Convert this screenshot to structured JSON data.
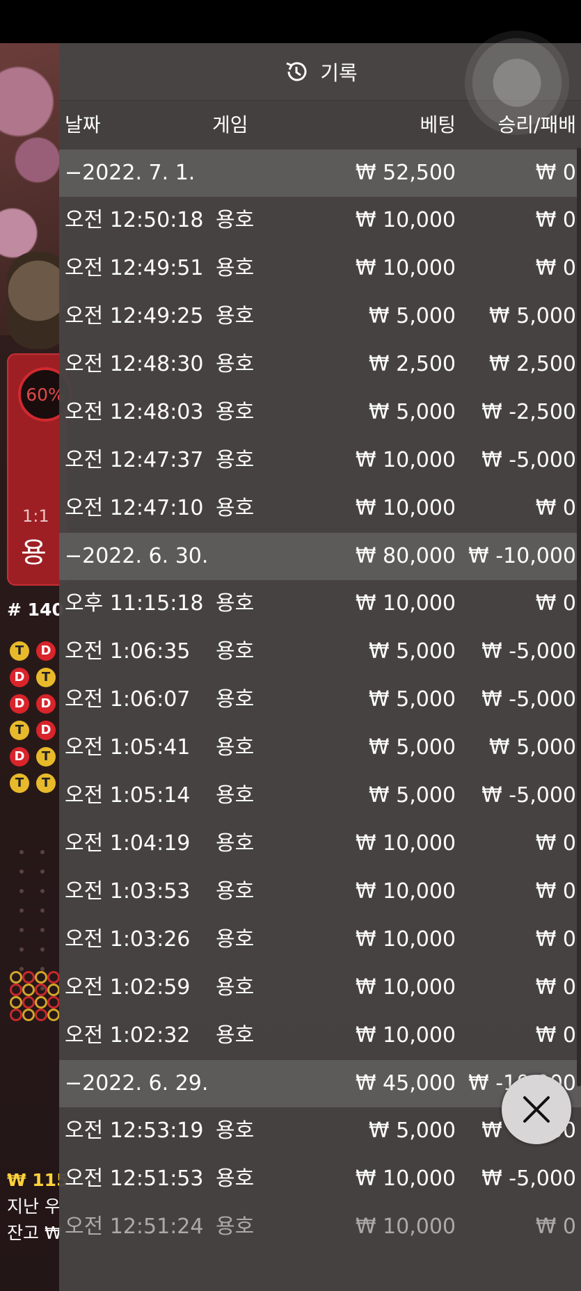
{
  "panel": {
    "title": "기록",
    "icon": "history-icon"
  },
  "columns": {
    "date": "날짜",
    "game": "게임",
    "bet": "베팅",
    "winloss": "승리/패배"
  },
  "groups": [
    {
      "date": "−2022. 7. 1.",
      "bet": "₩ 52,500",
      "result": "₩ 0",
      "rows": [
        {
          "time": "오전 12:50:18",
          "game": "용호",
          "bet": "₩ 10,000",
          "result": "₩ 0"
        },
        {
          "time": "오전 12:49:51",
          "game": "용호",
          "bet": "₩ 10,000",
          "result": "₩ 0"
        },
        {
          "time": "오전 12:49:25",
          "game": "용호",
          "bet": "₩ 5,000",
          "result": "₩ 5,000"
        },
        {
          "time": "오전 12:48:30",
          "game": "용호",
          "bet": "₩ 2,500",
          "result": "₩ 2,500"
        },
        {
          "time": "오전 12:48:03",
          "game": "용호",
          "bet": "₩ 5,000",
          "result": "₩ -2,500"
        },
        {
          "time": "오전 12:47:37",
          "game": "용호",
          "bet": "₩ 10,000",
          "result": "₩ -5,000"
        },
        {
          "time": "오전 12:47:10",
          "game": "용호",
          "bet": "₩ 10,000",
          "result": "₩ 0"
        }
      ]
    },
    {
      "date": "−2022. 6. 30.",
      "bet": "₩ 80,000",
      "result": "₩ -10,000",
      "rows": [
        {
          "time": "오후 11:15:18",
          "game": "용호",
          "bet": "₩ 10,000",
          "result": "₩ 0"
        },
        {
          "time": "오전 1:06:35",
          "game": "용호",
          "bet": "₩ 5,000",
          "result": "₩ -5,000"
        },
        {
          "time": "오전 1:06:07",
          "game": "용호",
          "bet": "₩ 5,000",
          "result": "₩ -5,000"
        },
        {
          "time": "오전 1:05:41",
          "game": "용호",
          "bet": "₩ 5,000",
          "result": "₩ 5,000"
        },
        {
          "time": "오전 1:05:14",
          "game": "용호",
          "bet": "₩ 5,000",
          "result": "₩ -5,000"
        },
        {
          "time": "오전 1:04:19",
          "game": "용호",
          "bet": "₩ 10,000",
          "result": "₩ 0"
        },
        {
          "time": "오전 1:03:53",
          "game": "용호",
          "bet": "₩ 10,000",
          "result": "₩ 0"
        },
        {
          "time": "오전 1:03:26",
          "game": "용호",
          "bet": "₩ 10,000",
          "result": "₩ 0"
        },
        {
          "time": "오전 1:02:59",
          "game": "용호",
          "bet": "₩ 10,000",
          "result": "₩ 0"
        },
        {
          "time": "오전 1:02:32",
          "game": "용호",
          "bet": "₩ 10,000",
          "result": "₩ 0"
        }
      ]
    },
    {
      "date": "−2022. 6. 29.",
      "bet": "₩ 45,000",
      "result": "₩ -10,000",
      "rows": [
        {
          "time": "오전 12:53:19",
          "game": "용호",
          "bet": "₩ 5,000",
          "result": "₩ -5,000"
        },
        {
          "time": "오전 12:51:53",
          "game": "용호",
          "bet": "₩ 10,000",
          "result": "₩ -5,000"
        },
        {
          "time": "오전 12:51:24",
          "game": "용호",
          "bet": "₩ 10,000",
          "result": "₩ 0"
        }
      ]
    }
  ],
  "background": {
    "pct": "60%",
    "odds": "1:1",
    "dragon": "용",
    "round": "# 140",
    "road": [
      [
        "T",
        "D"
      ],
      [
        "D",
        "T"
      ],
      [
        "D",
        "D"
      ],
      [
        "T",
        "D"
      ],
      [
        "D",
        "T"
      ],
      [
        "T",
        "T"
      ]
    ],
    "balance_label": "₩ 115",
    "last_win_label": "지난 우",
    "cash_label": "잔고 ₩"
  },
  "close_icon": "close-icon",
  "colors": {
    "panel": "#484444",
    "date_row": "#5d5a5a",
    "accent_red": "#9d1f24",
    "gold": "#e8b92a"
  }
}
